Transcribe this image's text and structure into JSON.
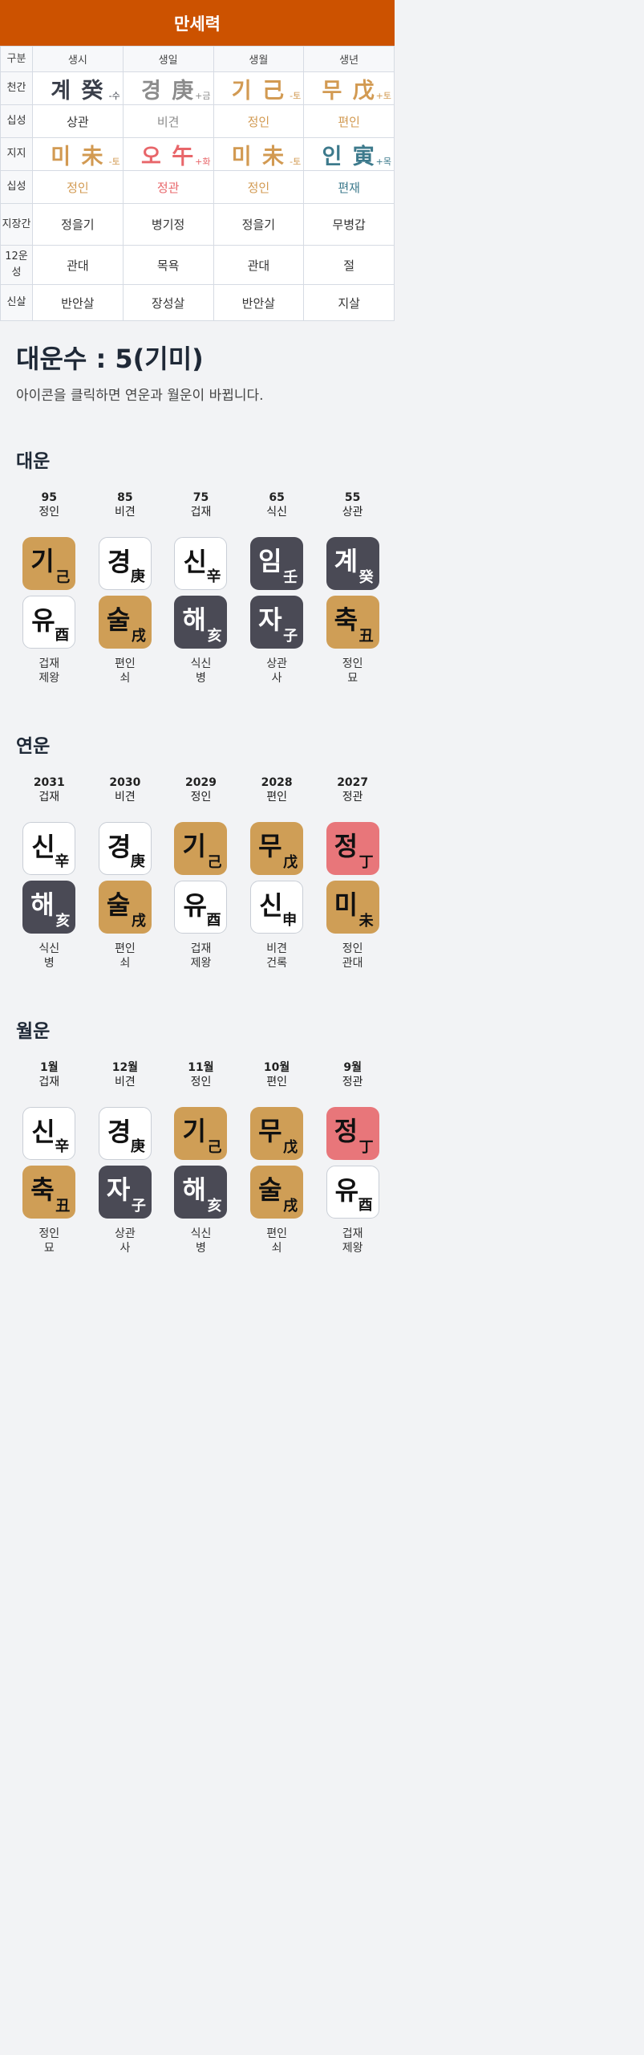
{
  "header": {
    "title": "만세력"
  },
  "table": {
    "corner": "구분",
    "columns": [
      "생시",
      "생일",
      "생월",
      "생년"
    ],
    "row_labels": {
      "cheongan": "천간",
      "sipseong_top": "십성",
      "jiji": "지지",
      "sipseong_bottom": "십성",
      "jijanggan": "지장간",
      "unseong": "12운성",
      "sinsal": "신살"
    },
    "cheongan": [
      {
        "text": "계 癸",
        "elem": "-수",
        "color": "#3a3f4a",
        "elem_color": "#3a3f4a"
      },
      {
        "text": "경 庚",
        "elem": "+금",
        "color": "#8c8c8c",
        "elem_color": "#8c8c8c"
      },
      {
        "text": "기 己",
        "elem": "-토",
        "color": "#d29a52",
        "elem_color": "#d29a52"
      },
      {
        "text": "무 戊",
        "elem": "+토",
        "color": "#d29a52",
        "elem_color": "#d29a52"
      }
    ],
    "sipseong_top": [
      {
        "text": "상관",
        "color": "#333333"
      },
      {
        "text": "비견",
        "color": "#8c8c8c"
      },
      {
        "text": "정인",
        "color": "#d29a52"
      },
      {
        "text": "편인",
        "color": "#d29a52"
      }
    ],
    "jiji": [
      {
        "text": "미 未",
        "elem": "-토",
        "color": "#d29a52",
        "elem_color": "#d29a52"
      },
      {
        "text": "오 午",
        "elem": "+화",
        "color": "#e8666a",
        "elem_color": "#e8666a"
      },
      {
        "text": "미 未",
        "elem": "-토",
        "color": "#d29a52",
        "elem_color": "#d29a52"
      },
      {
        "text": "인 寅",
        "elem": "+목",
        "color": "#3d7a8c",
        "elem_color": "#3d7a8c"
      }
    ],
    "sipseong_bottom": [
      {
        "text": "정인",
        "color": "#d29a52"
      },
      {
        "text": "정관",
        "color": "#e8666a"
      },
      {
        "text": "정인",
        "color": "#d29a52"
      },
      {
        "text": "편재",
        "color": "#3d7a8c"
      }
    ],
    "jijanggan": [
      "정을기",
      "병기정",
      "정을기",
      "무병갑"
    ],
    "unseong": [
      "관대",
      "목욕",
      "관대",
      "절"
    ],
    "sinsal": [
      "반안살",
      "장성살",
      "반안살",
      "지살"
    ]
  },
  "daeunsu": {
    "title": "대운수 : 5(기미)",
    "desc": "아이콘을 클릭하면 연운과 월운이 바뀝니다."
  },
  "daeun": {
    "title": "대운",
    "items": [
      {
        "top1": "95",
        "top2": "정인",
        "upper": {
          "k": "기",
          "h": "己",
          "bg": "gold"
        },
        "lower": {
          "k": "유",
          "h": "酉",
          "bg": "white"
        },
        "bot1": "겁재",
        "bot2": "제왕"
      },
      {
        "top1": "85",
        "top2": "비견",
        "upper": {
          "k": "경",
          "h": "庚",
          "bg": "white"
        },
        "lower": {
          "k": "술",
          "h": "戌",
          "bg": "gold"
        },
        "bot1": "편인",
        "bot2": "쇠"
      },
      {
        "top1": "75",
        "top2": "겁재",
        "upper": {
          "k": "신",
          "h": "辛",
          "bg": "white"
        },
        "lower": {
          "k": "해",
          "h": "亥",
          "bg": "dark"
        },
        "bot1": "식신",
        "bot2": "병"
      },
      {
        "top1": "65",
        "top2": "식신",
        "upper": {
          "k": "임",
          "h": "壬",
          "bg": "dark"
        },
        "lower": {
          "k": "자",
          "h": "子",
          "bg": "dark"
        },
        "bot1": "상관",
        "bot2": "사"
      },
      {
        "top1": "55",
        "top2": "상관",
        "upper": {
          "k": "계",
          "h": "癸",
          "bg": "dark"
        },
        "lower": {
          "k": "축",
          "h": "丑",
          "bg": "gold"
        },
        "bot1": "정인",
        "bot2": "묘"
      }
    ]
  },
  "yeonun": {
    "title": "연운",
    "items": [
      {
        "top1": "2031",
        "top2": "겁재",
        "upper": {
          "k": "신",
          "h": "辛",
          "bg": "white"
        },
        "lower": {
          "k": "해",
          "h": "亥",
          "bg": "dark"
        },
        "bot1": "식신",
        "bot2": "병"
      },
      {
        "top1": "2030",
        "top2": "비견",
        "upper": {
          "k": "경",
          "h": "庚",
          "bg": "white"
        },
        "lower": {
          "k": "술",
          "h": "戌",
          "bg": "gold"
        },
        "bot1": "편인",
        "bot2": "쇠"
      },
      {
        "top1": "2029",
        "top2": "정인",
        "upper": {
          "k": "기",
          "h": "己",
          "bg": "gold"
        },
        "lower": {
          "k": "유",
          "h": "酉",
          "bg": "white"
        },
        "bot1": "겁재",
        "bot2": "제왕"
      },
      {
        "top1": "2028",
        "top2": "편인",
        "upper": {
          "k": "무",
          "h": "戊",
          "bg": "gold"
        },
        "lower": {
          "k": "신",
          "h": "申",
          "bg": "white"
        },
        "bot1": "비견",
        "bot2": "건록"
      },
      {
        "top1": "2027",
        "top2": "정관",
        "upper": {
          "k": "정",
          "h": "丁",
          "bg": "red"
        },
        "lower": {
          "k": "미",
          "h": "未",
          "bg": "gold"
        },
        "bot1": "정인",
        "bot2": "관대"
      }
    ]
  },
  "wolun": {
    "title": "월운",
    "items": [
      {
        "top1": "1월",
        "top2": "겁재",
        "upper": {
          "k": "신",
          "h": "辛",
          "bg": "white"
        },
        "lower": {
          "k": "축",
          "h": "丑",
          "bg": "gold"
        },
        "bot1": "정인",
        "bot2": "묘"
      },
      {
        "top1": "12월",
        "top2": "비견",
        "upper": {
          "k": "경",
          "h": "庚",
          "bg": "white"
        },
        "lower": {
          "k": "자",
          "h": "子",
          "bg": "dark"
        },
        "bot1": "상관",
        "bot2": "사"
      },
      {
        "top1": "11월",
        "top2": "정인",
        "upper": {
          "k": "기",
          "h": "己",
          "bg": "gold"
        },
        "lower": {
          "k": "해",
          "h": "亥",
          "bg": "dark"
        },
        "bot1": "식신",
        "bot2": "병"
      },
      {
        "top1": "10월",
        "top2": "편인",
        "upper": {
          "k": "무",
          "h": "戊",
          "bg": "gold"
        },
        "lower": {
          "k": "술",
          "h": "戌",
          "bg": "gold"
        },
        "bot1": "편인",
        "bot2": "쇠"
      },
      {
        "top1": "9월",
        "top2": "정관",
        "upper": {
          "k": "정",
          "h": "丁",
          "bg": "red"
        },
        "lower": {
          "k": "유",
          "h": "酉",
          "bg": "white"
        },
        "bot1": "겁재",
        "bot2": "제왕"
      }
    ]
  }
}
